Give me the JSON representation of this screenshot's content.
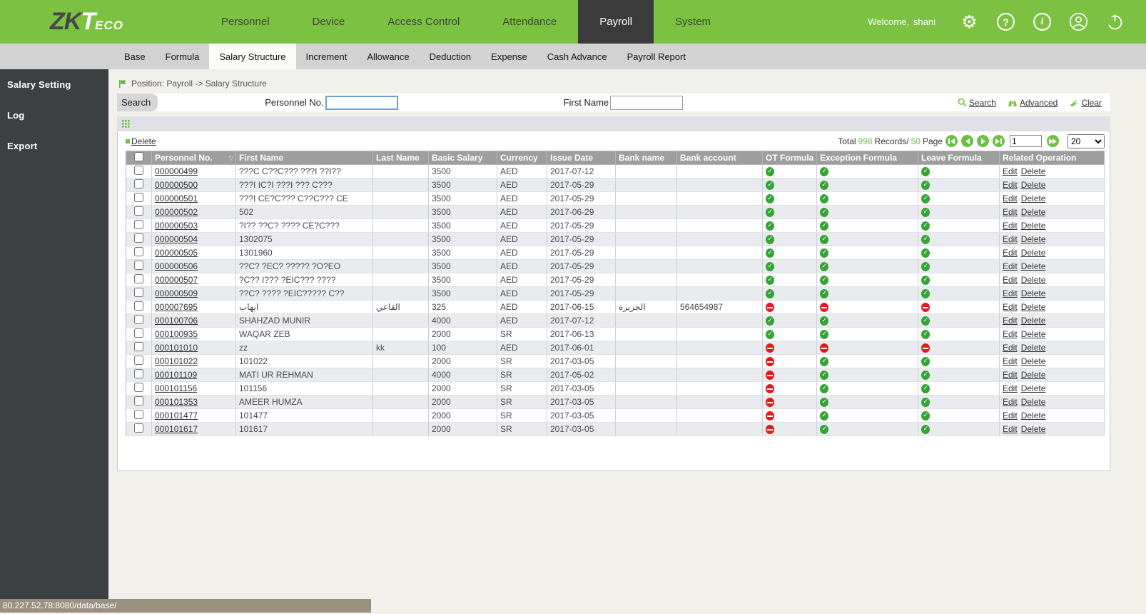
{
  "topnav": {
    "logo_zk": "ZK",
    "logo_t": "T",
    "logo_eco": "ECO",
    "items": [
      {
        "label": "Personnel",
        "active": false
      },
      {
        "label": "Device",
        "active": false
      },
      {
        "label": "Access Control",
        "active": false
      },
      {
        "label": "Attendance",
        "active": false
      },
      {
        "label": "Payroll",
        "active": true
      },
      {
        "label": "System",
        "active": false
      }
    ],
    "welcome": "Welcome,",
    "username": "shani",
    "icons": [
      "settings-icon",
      "help-icon",
      "info-icon",
      "account-icon",
      "power-icon"
    ],
    "accent_color": "#7cc142"
  },
  "subnav": {
    "tabs": [
      {
        "label": "Base",
        "active": false
      },
      {
        "label": "Formula",
        "active": false
      },
      {
        "label": "Salary Structure",
        "active": true
      },
      {
        "label": "Increment",
        "active": false
      },
      {
        "label": "Allowance",
        "active": false
      },
      {
        "label": "Deduction",
        "active": false
      },
      {
        "label": "Expense",
        "active": false
      },
      {
        "label": "Cash Advance",
        "active": false
      },
      {
        "label": "Payroll Report",
        "active": false
      }
    ]
  },
  "sidebar": {
    "items": [
      {
        "label": "Salary Setting"
      },
      {
        "label": "Log"
      },
      {
        "label": "Export"
      }
    ]
  },
  "breadcrumb": {
    "text": "Position: Payroll -> Salary Structure"
  },
  "search": {
    "panel_label": "Search",
    "fields": [
      {
        "label": "Personnel No.",
        "value": ""
      },
      {
        "label": "First Name",
        "value": ""
      }
    ],
    "actions": {
      "search": "Search",
      "advanced": "Advanced",
      "clear": "Clear"
    }
  },
  "toolbar": {
    "delete_label": "Delete"
  },
  "pagination": {
    "total_label": "Total",
    "total_count": "998",
    "records_label": "Records/",
    "page_count": "50",
    "page_label": "Page",
    "page_value": "1",
    "page_size": "20",
    "status_green": "#6cbf47"
  },
  "table": {
    "columns": [
      "Personnel No.",
      "First Name",
      "Last Name",
      "Basic Salary",
      "Currency",
      "Issue Date",
      "Bank name",
      "Bank account",
      "OT Formula",
      "Exception Formula",
      "Leave Formula",
      "Related Operation"
    ],
    "sorted_column": "Personnel No.",
    "row_actions": {
      "edit": "Edit",
      "delete": "Delete"
    },
    "status_ok_color": "#36a336",
    "status_blocked_color": "#e01b1b",
    "rows": [
      {
        "personnel_no": "000000499",
        "first_name": "???C C??C??? ???I ??I??",
        "last_name": "",
        "basic_salary": "3500",
        "currency": "AED",
        "issue_date": "2017-07-12",
        "bank_name": "",
        "bank_account": "",
        "ot_formula": "ok",
        "exception_formula": "ok",
        "leave_formula": "ok"
      },
      {
        "personnel_no": "000000500",
        "first_name": "???I IC?I ???I ??? C???",
        "last_name": "",
        "basic_salary": "3500",
        "currency": "AED",
        "issue_date": "2017-05-29",
        "bank_name": "",
        "bank_account": "",
        "ot_formula": "ok",
        "exception_formula": "ok",
        "leave_formula": "ok"
      },
      {
        "personnel_no": "000000501",
        "first_name": "???I CE?C??? C??C??? CE",
        "last_name": "",
        "basic_salary": "3500",
        "currency": "AED",
        "issue_date": "2017-05-29",
        "bank_name": "",
        "bank_account": "",
        "ot_formula": "ok",
        "exception_formula": "ok",
        "leave_formula": "ok"
      },
      {
        "personnel_no": "000000502",
        "first_name": "502",
        "last_name": "",
        "basic_salary": "3500",
        "currency": "AED",
        "issue_date": "2017-06-29",
        "bank_name": "",
        "bank_account": "",
        "ot_formula": "ok",
        "exception_formula": "ok",
        "leave_formula": "ok"
      },
      {
        "personnel_no": "000000503",
        "first_name": "?I?? ??C? ???? CE?C???",
        "last_name": "",
        "basic_salary": "3500",
        "currency": "AED",
        "issue_date": "2017-05-29",
        "bank_name": "",
        "bank_account": "",
        "ot_formula": "ok",
        "exception_formula": "ok",
        "leave_formula": "ok"
      },
      {
        "personnel_no": "000000504",
        "first_name": "1302075",
        "last_name": "",
        "basic_salary": "3500",
        "currency": "AED",
        "issue_date": "2017-05-29",
        "bank_name": "",
        "bank_account": "",
        "ot_formula": "ok",
        "exception_formula": "ok",
        "leave_formula": "ok"
      },
      {
        "personnel_no": "000000505",
        "first_name": "1301960",
        "last_name": "",
        "basic_salary": "3500",
        "currency": "AED",
        "issue_date": "2017-05-29",
        "bank_name": "",
        "bank_account": "",
        "ot_formula": "ok",
        "exception_formula": "ok",
        "leave_formula": "ok"
      },
      {
        "personnel_no": "000000506",
        "first_name": "??C? ?EC? ????? ?O?EO",
        "last_name": "",
        "basic_salary": "3500",
        "currency": "AED",
        "issue_date": "2017-05-29",
        "bank_name": "",
        "bank_account": "",
        "ot_formula": "ok",
        "exception_formula": "ok",
        "leave_formula": "ok"
      },
      {
        "personnel_no": "000000507",
        "first_name": "?C?? I??? ?EIC??? ????",
        "last_name": "",
        "basic_salary": "3500",
        "currency": "AED",
        "issue_date": "2017-05-29",
        "bank_name": "",
        "bank_account": "",
        "ot_formula": "ok",
        "exception_formula": "ok",
        "leave_formula": "ok"
      },
      {
        "personnel_no": "000000509",
        "first_name": "??C? ???? ?EIC????? C??",
        "last_name": "",
        "basic_salary": "3500",
        "currency": "AED",
        "issue_date": "2017-05-29",
        "bank_name": "",
        "bank_account": "",
        "ot_formula": "ok",
        "exception_formula": "ok",
        "leave_formula": "ok"
      },
      {
        "personnel_no": "000007695",
        "first_name": "ايهاب",
        "last_name": "القاعي",
        "basic_salary": "325",
        "currency": "AED",
        "issue_date": "2017-06-15",
        "bank_name": "الجزيره",
        "bank_account": "564654987",
        "ot_formula": "no",
        "exception_formula": "no",
        "leave_formula": "no"
      },
      {
        "personnel_no": "000100706",
        "first_name": "SHAHZAD MUNIR",
        "last_name": "",
        "basic_salary": "4000",
        "currency": "AED",
        "issue_date": "2017-07-12",
        "bank_name": "",
        "bank_account": "",
        "ot_formula": "ok",
        "exception_formula": "ok",
        "leave_formula": "ok"
      },
      {
        "personnel_no": "000100935",
        "first_name": "WAQAR ZEB",
        "last_name": "",
        "basic_salary": "2000",
        "currency": "SR",
        "issue_date": "2017-06-13",
        "bank_name": "",
        "bank_account": "",
        "ot_formula": "ok",
        "exception_formula": "ok",
        "leave_formula": "ok"
      },
      {
        "personnel_no": "000101010",
        "first_name": "zz",
        "last_name": "kk",
        "basic_salary": "100",
        "currency": "AED",
        "issue_date": "2017-06-01",
        "bank_name": "",
        "bank_account": "",
        "ot_formula": "no",
        "exception_formula": "no",
        "leave_formula": "no"
      },
      {
        "personnel_no": "000101022",
        "first_name": "101022",
        "last_name": "",
        "basic_salary": "2000",
        "currency": "SR",
        "issue_date": "2017-03-05",
        "bank_name": "",
        "bank_account": "",
        "ot_formula": "no",
        "exception_formula": "ok",
        "leave_formula": "ok"
      },
      {
        "personnel_no": "000101109",
        "first_name": "MATI UR REHMAN",
        "last_name": "",
        "basic_salary": "4000",
        "currency": "SR",
        "issue_date": "2017-05-02",
        "bank_name": "",
        "bank_account": "",
        "ot_formula": "no",
        "exception_formula": "ok",
        "leave_formula": "ok"
      },
      {
        "personnel_no": "000101156",
        "first_name": "101156",
        "last_name": "",
        "basic_salary": "2000",
        "currency": "SR",
        "issue_date": "2017-03-05",
        "bank_name": "",
        "bank_account": "",
        "ot_formula": "no",
        "exception_formula": "ok",
        "leave_formula": "ok"
      },
      {
        "personnel_no": "000101353",
        "first_name": "AMEER HUMZA",
        "last_name": "",
        "basic_salary": "2000",
        "currency": "SR",
        "issue_date": "2017-03-05",
        "bank_name": "",
        "bank_account": "",
        "ot_formula": "no",
        "exception_formula": "ok",
        "leave_formula": "ok"
      },
      {
        "personnel_no": "000101477",
        "first_name": "101477",
        "last_name": "",
        "basic_salary": "2000",
        "currency": "SR",
        "issue_date": "2017-03-05",
        "bank_name": "",
        "bank_account": "",
        "ot_formula": "no",
        "exception_formula": "ok",
        "leave_formula": "ok"
      },
      {
        "personnel_no": "000101617",
        "first_name": "101617",
        "last_name": "",
        "basic_salary": "2000",
        "currency": "SR",
        "issue_date": "2017-03-05",
        "bank_name": "",
        "bank_account": "",
        "ot_formula": "no",
        "exception_formula": "ok",
        "leave_formula": "ok"
      }
    ]
  },
  "statusbar": {
    "url": "80.227.52.78:8080/data/base/"
  }
}
